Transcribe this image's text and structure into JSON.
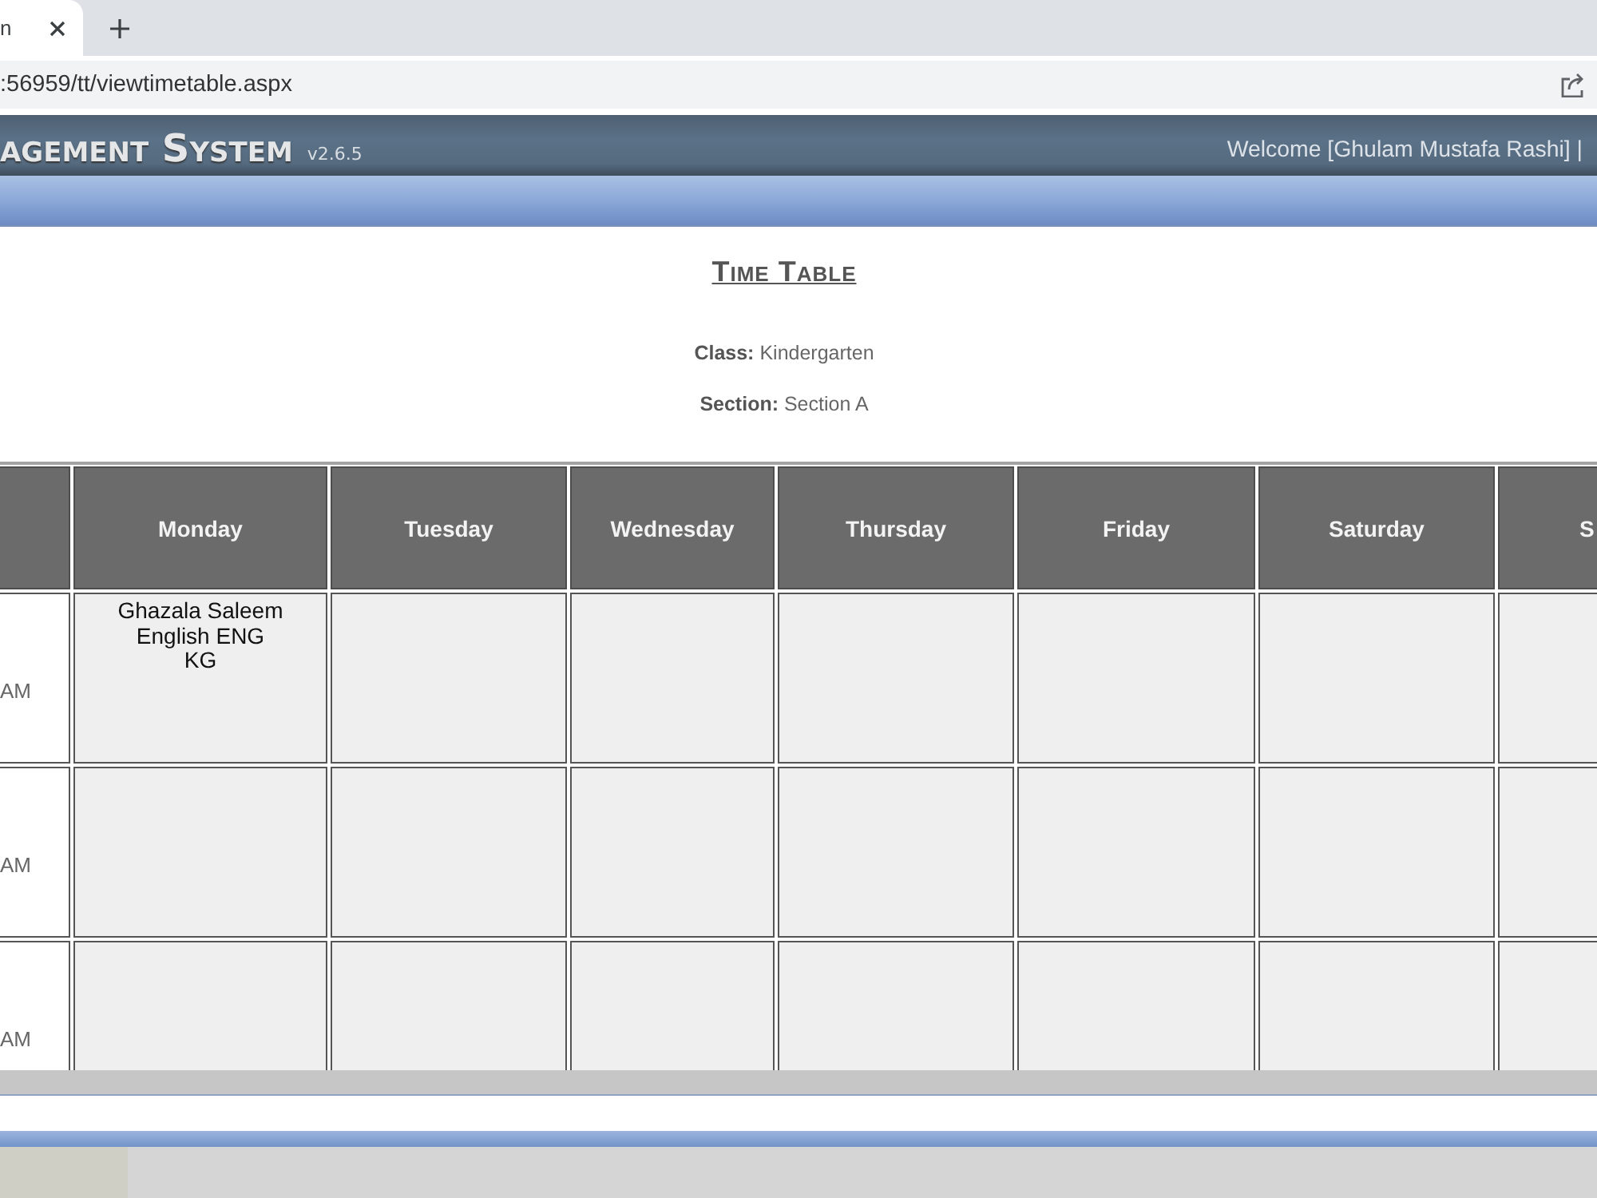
{
  "browser": {
    "tabs": [
      {
        "title": "n",
        "selected": true
      }
    ],
    "address_bar": {
      "url": ":56959/tt/viewtimetable.aspx"
    }
  },
  "header": {
    "title": "agement System",
    "version": "v2.6.5",
    "welcome": "Welcome [Ghulam Mustafa Rashi] |"
  },
  "content": {
    "title": "Time Table",
    "details": [
      {
        "label": "Class:",
        "value": "Kindergarten"
      },
      {
        "label": "Section:",
        "value": "Section A"
      }
    ]
  },
  "timetable": {
    "columns": [
      "Monday",
      "Tuesday",
      "Wednesday",
      "Thursday",
      "Friday",
      "Saturday",
      "S"
    ],
    "rows": [
      {
        "time": "AM",
        "cells": [
          {
            "lines": [
              "Ghazala Saleem",
              "English ENG",
              "KG"
            ]
          },
          null,
          null,
          null,
          null,
          null,
          null
        ]
      },
      {
        "time": "AM",
        "cells": [
          null,
          null,
          null,
          null,
          null,
          null,
          null
        ]
      },
      {
        "time": "AM",
        "cells": [
          null,
          null,
          null,
          null,
          null,
          null,
          null
        ]
      }
    ]
  }
}
